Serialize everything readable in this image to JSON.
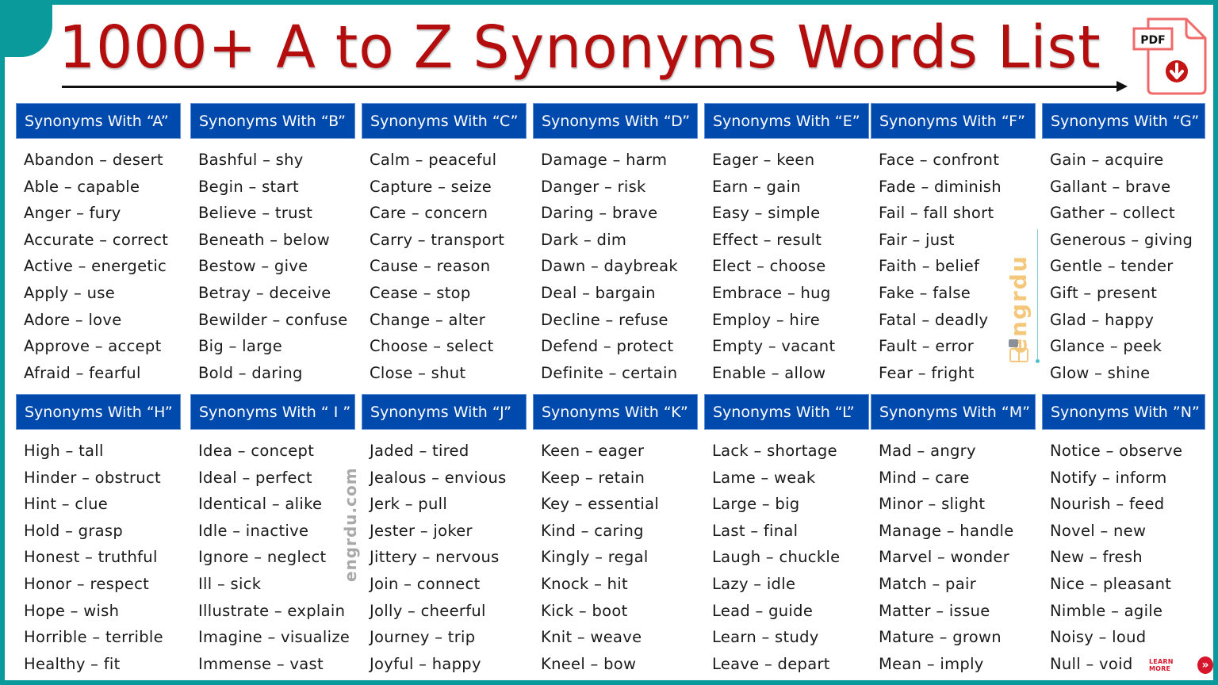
{
  "title": "1000+ A to Z Synonyms Words List",
  "pdf_icon": {
    "label": "PDF",
    "icon": "pdf-download-icon"
  },
  "colors": {
    "frame": "#0a9a9c",
    "title": "#b30d0d",
    "header_bg": "#0049ad",
    "learn_more": "#d8162b"
  },
  "watermarks": {
    "vertical_site": "engrdu.com",
    "brand": "engrdu"
  },
  "learn_more": {
    "label": "LEARN MORE",
    "icon": "double-chevron-right-icon"
  },
  "sections": [
    {
      "letter": "A",
      "header": "Synonyms With “A”",
      "items": [
        "Abandon – desert",
        "Able – capable",
        "Anger – fury",
        "Accurate – correct",
        "Active – energetic",
        "Apply – use",
        "Adore – love",
        "Approve – accept",
        "Afraid – fearful"
      ]
    },
    {
      "letter": "B",
      "header": "Synonyms With “B”",
      "items": [
        "Bashful – shy",
        "Begin – start",
        "Believe – trust",
        "Beneath – below",
        "Bestow – give",
        "Betray – deceive",
        "Bewilder – confuse",
        "Big – large",
        "Bold – daring"
      ]
    },
    {
      "letter": "C",
      "header": "Synonyms With “C”",
      "items": [
        "Calm – peaceful",
        "Capture – seize",
        "Care – concern",
        "Carry – transport",
        "Cause – reason",
        "Cease – stop",
        "Change – alter",
        "Choose – select",
        "Close – shut"
      ]
    },
    {
      "letter": "D",
      "header": "Synonyms With “D”",
      "items": [
        "Damage – harm",
        "Danger – risk",
        "Daring – brave",
        "Dark – dim",
        "Dawn – daybreak",
        "Deal – bargain",
        "Decline – refuse",
        "Defend – protect",
        "Definite – certain"
      ]
    },
    {
      "letter": "E",
      "header": "Synonyms With “E”",
      "items": [
        "Eager – keen",
        "Earn – gain",
        "Easy – simple",
        "Effect – result",
        "Elect – choose",
        "Embrace – hug",
        "Employ – hire",
        "Empty – vacant",
        "Enable – allow"
      ]
    },
    {
      "letter": "F",
      "header": "Synonyms With “F”",
      "items": [
        "Face – confront",
        "Fade – diminish",
        "Fail – fall short",
        "Fair – just",
        "Faith – belief",
        "Fake – false",
        "Fatal – deadly",
        "Fault – error",
        "Fear – fright"
      ]
    },
    {
      "letter": "G",
      "header": "Synonyms With “G”",
      "items": [
        "Gain – acquire",
        "Gallant – brave",
        "Gather – collect",
        "Generous – giving",
        "Gentle – tender",
        "Gift – present",
        "Glad – happy",
        "Glance – peek",
        "Glow – shine"
      ]
    },
    {
      "letter": "H",
      "header": "Synonyms With “H”",
      "items": [
        "High – tall",
        "Hinder – obstruct",
        "Hint – clue",
        "Hold – grasp",
        "Honest – truthful",
        "Honor – respect",
        "Hope – wish",
        "Horrible – terrible",
        "Healthy – fit"
      ]
    },
    {
      "letter": "I",
      "header": "Synonyms With “ I ”",
      "items": [
        "Idea – concept",
        "Ideal – perfect",
        "Identical – alike",
        "Idle – inactive",
        "Ignore – neglect",
        "Ill – sick",
        "Illustrate – explain",
        "Imagine – visualize",
        "Immense – vast"
      ]
    },
    {
      "letter": "J",
      "header": "Synonyms With “J”",
      "items": [
        "Jaded – tired",
        "Jealous – envious",
        "Jerk – pull",
        "Jester – joker",
        "Jittery – nervous",
        "Join – connect",
        "Jolly – cheerful",
        "Journey – trip",
        "Joyful – happy"
      ]
    },
    {
      "letter": "K",
      "header": "Synonyms With “K”",
      "items": [
        "Keen – eager",
        "Keep – retain",
        "Key – essential",
        "Kind – caring",
        "Kingly – regal",
        "Knock – hit",
        "Kick – boot",
        "Knit – weave",
        "Kneel – bow"
      ]
    },
    {
      "letter": "L",
      "header": "Synonyms With “L”",
      "items": [
        "Lack – shortage",
        "Lame – weak",
        "Large – big",
        "Last – final",
        "Laugh – chuckle",
        "Lazy – idle",
        "Lead – guide",
        "Learn – study",
        "Leave – depart"
      ]
    },
    {
      "letter": "M",
      "header": "Synonyms With “M”",
      "items": [
        "Mad – angry",
        "Mind – care",
        "Minor – slight",
        "Manage – handle",
        "Marvel – wonder",
        "Match – pair",
        "Matter – issue",
        "Mature – grown",
        "Mean – imply"
      ]
    },
    {
      "letter": "N",
      "header": "Synonyms With ”N”",
      "items": [
        "Notice – observe",
        "Notify – inform",
        "Nourish – feed",
        "Novel – new",
        "New – fresh",
        "Nice – pleasant",
        "Nimble – agile",
        "Noisy – loud",
        "Null – void"
      ]
    }
  ]
}
